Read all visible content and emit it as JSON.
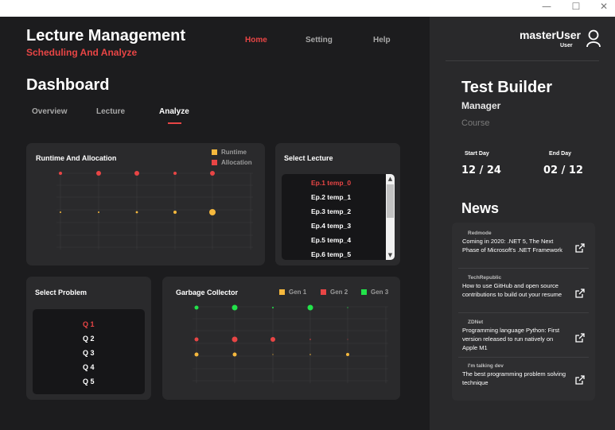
{
  "window": {
    "minimize": "—",
    "maximize": "☐",
    "close": "✕"
  },
  "header": {
    "title": "Lecture Management",
    "subtitle": "Scheduling And Analyze",
    "nav": [
      "Home",
      "Setting",
      "Help"
    ]
  },
  "dashboard": {
    "title": "Dashboard",
    "tabs": [
      "Overview",
      "Lecture",
      "Analyze"
    ],
    "active_tab": "Analyze"
  },
  "runtime": {
    "title": "Runtime And Allocation",
    "legend": [
      "Runtime",
      "Allocation"
    ],
    "colors": {
      "runtime": "#f5b83d",
      "allocation": "#e84545"
    }
  },
  "select_lecture": {
    "title": "Select Lecture",
    "items": [
      "Ep.1 temp_0",
      "Ep.2 temp_1",
      "Ep.3 temp_2",
      "Ep.4 temp_3",
      "Ep.5 temp_4",
      "Ep.6 temp_5"
    ],
    "selected": "Ep.1 temp_0"
  },
  "select_problem": {
    "title": "Select Problem",
    "items": [
      "Q 1",
      "Q 2",
      "Q 3",
      "Q 4",
      "Q 5"
    ],
    "selected": "Q 1"
  },
  "garbage": {
    "title": "Garbage Collector",
    "legend": [
      "Gen 1",
      "Gen 2",
      "Gen 3"
    ],
    "colors": {
      "gen1": "#f5b83d",
      "gen2": "#e84545",
      "gen3": "#22e34a"
    }
  },
  "user": {
    "name": "masterUser",
    "role": "User"
  },
  "test_builder": {
    "title": "Test Builder",
    "role": "Manager",
    "course": "Course",
    "start_label": "Start Day",
    "end_label": "End Day",
    "start_value": "12 / 24",
    "end_value": "02 / 12"
  },
  "news": {
    "title": "News",
    "items": [
      {
        "source": "Redmode",
        "text": "Coming in 2020: .NET 5, The Next Phase of Microsoft's .NET Framework"
      },
      {
        "source": "TechRepublic",
        "text": "How to use GitHub and open source contributions to build out your resume"
      },
      {
        "source": "ZDNet",
        "text": "Programming language Python: First version released to run natively on Apple M1"
      },
      {
        "source": "I'm talking dev",
        "text": "The best programming problem solving technique"
      }
    ]
  },
  "accent": "#e84545"
}
